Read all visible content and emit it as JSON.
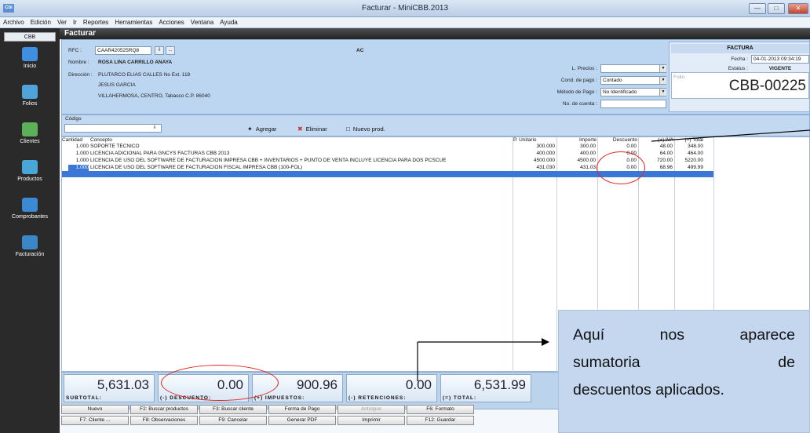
{
  "window": {
    "title": "Facturar - MiniCBB.2013",
    "app_icon": "Cbi"
  },
  "menu": [
    "Archivo",
    "Edición",
    "Ver",
    "Ir",
    "Reportes",
    "Herramientas",
    "Acciones",
    "Ventana",
    "Ayuda"
  ],
  "sidebar": {
    "header": "CBB",
    "items": [
      {
        "label": "Inicio",
        "icon": "home-icon"
      },
      {
        "label": "Folios",
        "icon": "folios-icon"
      },
      {
        "label": "Clientes",
        "icon": "clients-icon"
      },
      {
        "label": "Productos",
        "icon": "products-icon"
      },
      {
        "label": "Comprobantes",
        "icon": "receipts-icon"
      },
      {
        "label": "Facturación",
        "icon": "invoice-icon"
      }
    ]
  },
  "form_title": "Facturar",
  "client": {
    "rfc_label": "RFC :",
    "rfc": "CAAR420525RQ8",
    "regime": "AC",
    "name_label": "Nombre :",
    "name": "ROSA LINA CARRILLO ANAYA",
    "address_label": "Dirección :",
    "address1": "PLUTARCO ELIAS CALLES No Ext. 118",
    "address2": "JESUS GARCIA",
    "address3": "VILLAHERMOSA, CENTRO, Tabasco C.P. 86040"
  },
  "payment": {
    "precios_label": "L. Precios :",
    "precios": "",
    "cond_label": "Cond. de pago :",
    "cond": "Contado",
    "metodo_label": "Método de Pago :",
    "metodo": "No Identificado",
    "cuenta_label": "No. de cuenta :",
    "cuenta": ""
  },
  "factura": {
    "header": "FACTURA",
    "fecha_label": "Fecha :",
    "fecha": "04-01-2013 09:34:19",
    "estatus_label": "Estatus :",
    "estatus": "VIGENTE",
    "folio_label": "Folio :",
    "folio": "CBB-00225"
  },
  "toolbar": {
    "codigo_label": "Código",
    "agregar": "Agregar",
    "eliminar": "Eliminar",
    "nuevo": "Nuevo prod."
  },
  "columns": {
    "cantidad": "Cantidad",
    "concepto": "Concepto",
    "p_unitario": "P. Unitario",
    "importe": "Importe",
    "descuento": "Descuento",
    "iva": "(+) IVA",
    "total": "(=) Total"
  },
  "rows": [
    {
      "cantidad": "1.000",
      "concepto": "SOPORTE TECNICO",
      "p_unitario": "300.000",
      "importe": "300.00",
      "descuento": "0.00",
      "iva": "48.00",
      "total": "348.00"
    },
    {
      "cantidad": "1.000",
      "concepto": "LICENCIA ADICIONAL PARA GNCYS FACTURAS CBB 2013",
      "p_unitario": "400.000",
      "importe": "400.00",
      "descuento": "0.00",
      "iva": "64.00",
      "total": "464.00"
    },
    {
      "cantidad": "1.000",
      "concepto": "LICENCIA DE USO DEL SOFTWARE DE FACTURACION IMPRESA CBB + INVENTARIOS + PUNTO DE VENTA INCLUYE LICENCIA PARA DOS PCSCUE",
      "p_unitario": "4500.000",
      "importe": "4500.00",
      "descuento": "0.00",
      "iva": "720.00",
      "total": "5220.00"
    },
    {
      "cantidad": "1.000",
      "concepto": "LICENCIA DE USO DEL SOFTWARE DE FACTURACIÓN FISCAL IMPRESA CBB (100-FOL)",
      "p_unitario": "431.030",
      "importe": "431.03",
      "descuento": "0.00",
      "iva": "68.96",
      "total": "499.99"
    }
  ],
  "totals": {
    "subtotal": "5,631.03",
    "subtotal_label": "SUBTOTAL:",
    "descuento": "0.00",
    "descuento_label": "(-) DESCUENTO:",
    "impuestos": "900.96",
    "impuestos_label": "(+) IMPUESTOS:",
    "retenciones": "0.00",
    "retenciones_label": "(-) RETENCIONES:",
    "total": "6,531.99",
    "total_label": "(=) TOTAL:"
  },
  "buttons_row1": [
    "Nuevo",
    "F2: Buscar productos",
    "F3: Buscar cliente",
    "Forma de Pago",
    "Anticipos",
    "F6: Formato"
  ],
  "buttons_row2": [
    "F7: Cliente ...",
    "F8: Observaciones",
    "F9: Cancelar",
    "Generar PDF",
    "Imprimir",
    "F12: Guardar"
  ],
  "callout": {
    "line1": "Aquí nos aparece",
    "line2": "sumatoria de",
    "line3": "descuentos aplicados."
  },
  "annotation_color": "#e0261b"
}
